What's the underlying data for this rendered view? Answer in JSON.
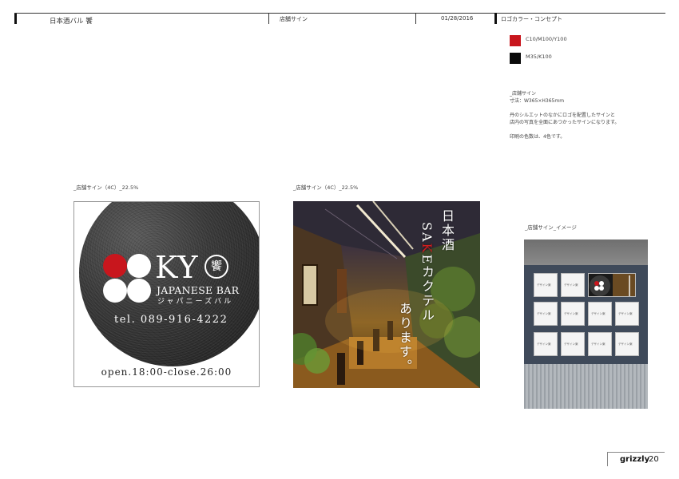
{
  "header": {
    "title": "日本酒バル 饗",
    "section": "店舗サイン",
    "date": "01/28/2016",
    "right_section": "ロゴカラー・コンセプト"
  },
  "colors": {
    "swatch_red": "#c8161d",
    "swatch_black": "#0a0a0a",
    "red_label": "C10/M100/Y100",
    "black_label": "M35/K100"
  },
  "concept": {
    "line1": "_店舗サイン",
    "line2": "寸法：W365×H365mm",
    "line3": "丹のシルエットのなかにロゴを配置したサインと",
    "line4": "店内の写真を全面にあつかったサインになります。",
    "line5": "印刷の色数は、4色です。"
  },
  "captions": {
    "sign1": "_店舗サイン（4C）_22.5%",
    "sign2": "_店舗サイン（4C）_22.5%",
    "image": "_店舗サイン_イメージ"
  },
  "sign1": {
    "logo": "KY",
    "logo_kanji": "饗",
    "logo_en": "JAPANESE BAR",
    "logo_kana": "ジャパニーズバル",
    "tel": "tel. 089-916-4222",
    "hours": "open.18:00-close.26:00"
  },
  "sign2": {
    "line1": "日本酒",
    "line2_pre": "SA",
    "line2_red": "K",
    "line2_post": "Eカクテル",
    "line3": "あります。"
  },
  "footer": {
    "brand": "grizzly",
    "page": "20"
  }
}
